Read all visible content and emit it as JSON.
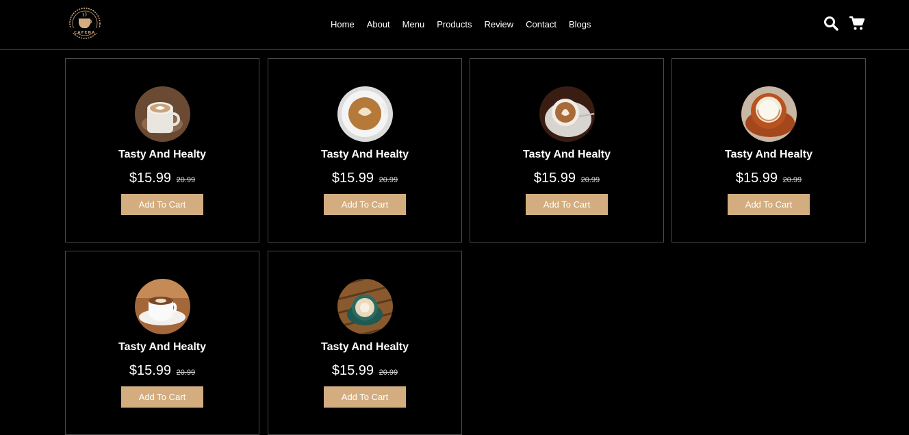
{
  "header": {
    "logo_text": "CAFENA",
    "nav": [
      "Home",
      "About",
      "Menu",
      "Products",
      "Review",
      "Contact",
      "Blogs"
    ],
    "icons": [
      "search-icon",
      "cart-icon"
    ]
  },
  "products": [
    {
      "title": "Tasty And Healty",
      "price": "$15.99",
      "old_price": "20.99",
      "button": "Add To Cart"
    },
    {
      "title": "Tasty And Healty",
      "price": "$15.99",
      "old_price": "20.99",
      "button": "Add To Cart"
    },
    {
      "title": "Tasty And Healty",
      "price": "$15.99",
      "old_price": "20.99",
      "button": "Add To Cart"
    },
    {
      "title": "Tasty And Healty",
      "price": "$15.99",
      "old_price": "20.99",
      "button": "Add To Cart"
    },
    {
      "title": "Tasty And Healty",
      "price": "$15.99",
      "old_price": "20.99",
      "button": "Add To Cart"
    },
    {
      "title": "Tasty And Healty",
      "price": "$15.99",
      "old_price": "20.99",
      "button": "Add To Cart"
    }
  ],
  "colors": {
    "background": "#000000",
    "accent": "#d3ad7f",
    "border": "#4a4a4a"
  }
}
